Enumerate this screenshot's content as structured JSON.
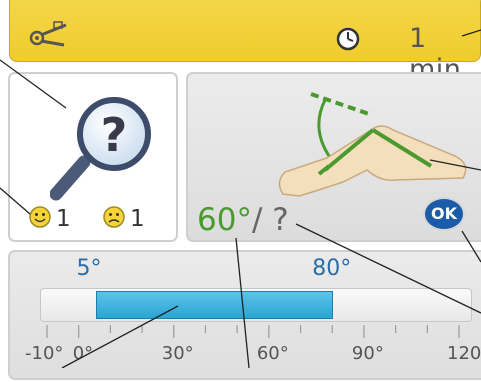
{
  "header": {
    "tool_icon": "goniometer-icon",
    "clock_icon": "clock-icon",
    "duration": "1 min"
  },
  "help_panel": {
    "icon": "magnifier-question-icon",
    "ratings": [
      {
        "icon": "happy-face-icon",
        "count": "1"
      },
      {
        "icon": "sad-face-icon",
        "count": "1"
      }
    ]
  },
  "leg_panel": {
    "illustration": "knee-flexion-leg-icon",
    "measured_angle": "60°",
    "target_angle": "/ ?",
    "ok_label": "OK"
  },
  "range": {
    "min_label": "5°",
    "max_label": "80°",
    "min_value": 5,
    "max_value": 80,
    "scale_min": -10,
    "scale_max": 120,
    "tick_labels": [
      "-10°",
      "0°",
      "30°",
      "60°",
      "90°",
      "120°"
    ],
    "tick_values": [
      -10,
      0,
      30,
      60,
      90,
      120
    ],
    "fill_color": "#33b0e0"
  },
  "colors": {
    "header_yellow": "#f0cc2c",
    "ok_blue": "#1a5ca8",
    "angle_green": "#4a9a30"
  }
}
